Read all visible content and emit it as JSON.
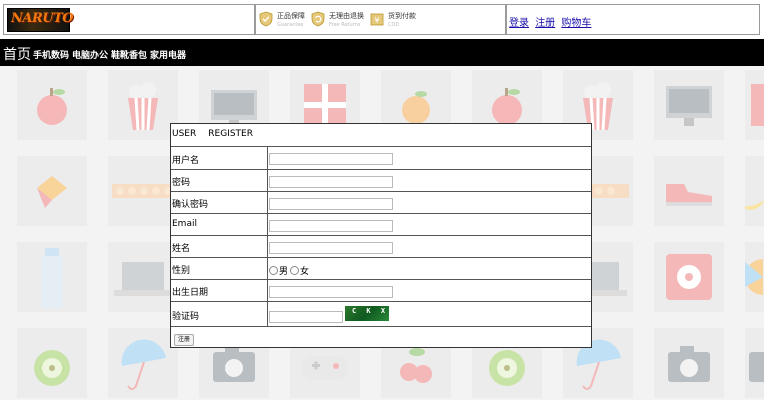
{
  "header": {
    "logo_text": "NARUTO",
    "services": [
      {
        "icon": "shield-check-icon",
        "title": "正品保障",
        "subtitle": "Guarantee"
      },
      {
        "icon": "return-shield-icon",
        "title": "无理由退换",
        "subtitle": "Free Returns"
      },
      {
        "icon": "cash-on-delivery-icon",
        "title": "货到付款",
        "subtitle": "COD"
      }
    ],
    "links": {
      "login": "登录",
      "register": "注册",
      "cart": "购物车"
    }
  },
  "nav": {
    "home": "首页",
    "items": [
      "手机数码",
      "电脑办公",
      "鞋靴香包",
      "家用电器"
    ]
  },
  "form": {
    "title_left": "USER",
    "title_right": "REGISTER",
    "fields": {
      "username": "用户名",
      "password": "密码",
      "confirm": "确认密码",
      "email": "Email",
      "name": "姓名",
      "gender": "性别",
      "birthday": "出生日期",
      "captcha": "验证码"
    },
    "gender_options": [
      "男",
      "女"
    ],
    "captcha_text": "C K X",
    "submit": "注册"
  },
  "colors": {
    "nav_bg": "#000000",
    "link": "#1a0dab",
    "captcha_bg": "#1f6b2a"
  }
}
